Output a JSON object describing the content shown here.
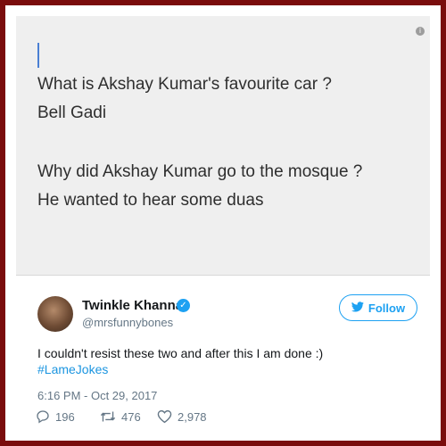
{
  "note": {
    "lines": [
      "What is Akshay Kumar's favourite car ?",
      "Bell Gadi",
      "Why did Akshay Kumar go to the mosque ?",
      "He wanted to hear some duas"
    ]
  },
  "tweet": {
    "display_name": "Twinkle Khanna",
    "handle": "@mrsfunnybones",
    "follow_label": "Follow",
    "text": "I couldn't resist these two and after this I am done :)",
    "hashtag": "#LameJokes",
    "timestamp": "6:16 PM - Oct 29, 2017",
    "replies": "196",
    "retweets": "476",
    "likes": "2,978"
  },
  "icons": {
    "info": "info-icon",
    "verified": "verified-badge-icon",
    "follow": "twitter-bird-icon",
    "reply": "reply-icon",
    "retweet": "retweet-icon",
    "like": "heart-icon"
  },
  "colors": {
    "frame": "#7a0d0d",
    "twitter_blue": "#1da1f2",
    "link": "#1b95e0",
    "muted": "#657786"
  }
}
